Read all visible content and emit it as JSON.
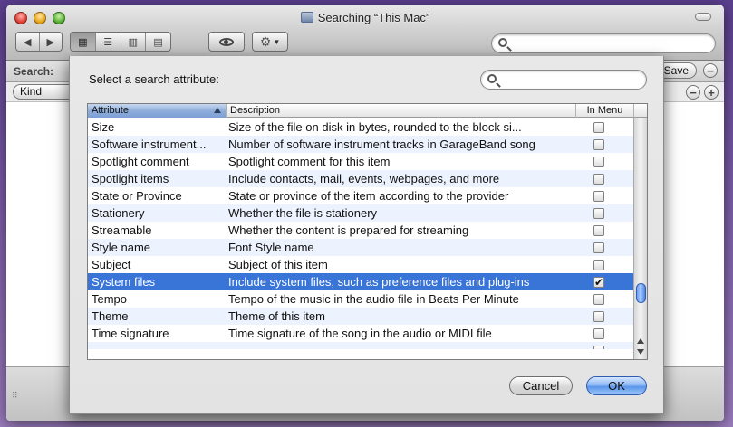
{
  "window": {
    "title": "Searching “This Mac”"
  },
  "searchbar": {
    "label": "Search:",
    "save_label": "Save",
    "remove_symbol": "−"
  },
  "criteria": {
    "kind_label": "Kind",
    "remove_symbol": "−",
    "add_symbol": "+"
  },
  "sheet": {
    "prompt": "Select a search attribute:",
    "search_placeholder": "",
    "columns": {
      "attribute": "Attribute",
      "description": "Description",
      "in_menu": "In Menu"
    },
    "rows": [
      {
        "attribute": "Size",
        "description": "Size of the file on disk in bytes, rounded to the block si...",
        "in_menu": false,
        "selected": false
      },
      {
        "attribute": "Software instrument...",
        "description": "Number of software instrument tracks in GarageBand song",
        "in_menu": false,
        "selected": false
      },
      {
        "attribute": "Spotlight comment",
        "description": "Spotlight comment for this item",
        "in_menu": false,
        "selected": false
      },
      {
        "attribute": "Spotlight items",
        "description": "Include contacts, mail, events, webpages, and more",
        "in_menu": false,
        "selected": false
      },
      {
        "attribute": "State or Province",
        "description": "State or province of the item according to the provider",
        "in_menu": false,
        "selected": false
      },
      {
        "attribute": "Stationery",
        "description": "Whether the file is stationery",
        "in_menu": false,
        "selected": false
      },
      {
        "attribute": "Streamable",
        "description": "Whether the content is prepared for streaming",
        "in_menu": false,
        "selected": false
      },
      {
        "attribute": "Style name",
        "description": "Font Style name",
        "in_menu": false,
        "selected": false
      },
      {
        "attribute": "Subject",
        "description": "Subject of this item",
        "in_menu": false,
        "selected": false
      },
      {
        "attribute": "System files",
        "description": "Include system files, such as preference files and plug-ins",
        "in_menu": true,
        "selected": true
      },
      {
        "attribute": "Tempo",
        "description": "Tempo of the music in the audio file in Beats Per Minute",
        "in_menu": false,
        "selected": false
      },
      {
        "attribute": "Theme",
        "description": "Theme of this item",
        "in_menu": false,
        "selected": false
      },
      {
        "attribute": "Time signature",
        "description": "Time signature of the song in the audio or MIDI file",
        "in_menu": false,
        "selected": false
      }
    ],
    "cancel_label": "Cancel",
    "ok_label": "OK",
    "check_glyph": "✔"
  },
  "colors": {
    "selection": "#3875d7",
    "default_button": "#5a95ea"
  }
}
